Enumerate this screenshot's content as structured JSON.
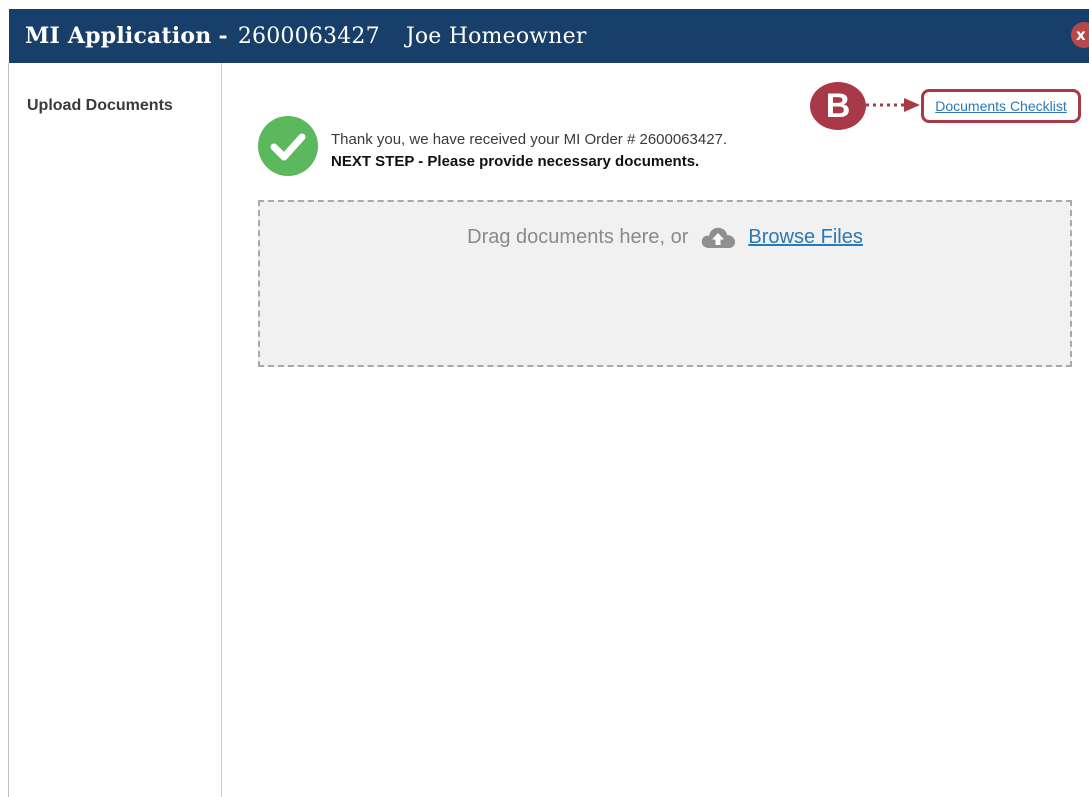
{
  "window": {
    "title_app": "MI Application",
    "title_separator": "-",
    "order_number": "2600063427",
    "applicant_name": "Joe Homeowner",
    "close_symbol": "x"
  },
  "sidebar": {
    "items": [
      {
        "label": "Upload Documents"
      }
    ]
  },
  "main": {
    "confirmation_line1": "Thank you, we have received your MI Order # 2600063427.",
    "confirmation_line2": "NEXT STEP - Please provide necessary documents.",
    "dropzone_text": "Drag documents here, or",
    "browse_label": "Browse Files",
    "checklist_label": "Documents Checklist"
  },
  "annotation": {
    "callout_letter": "B"
  },
  "icons": {
    "success": "check-circle-icon",
    "upload": "cloud-upload-icon",
    "close": "close-icon"
  },
  "colors": {
    "titlebar": "#173f6a",
    "success": "#5cb85c",
    "link": "#2a79b8",
    "callout": "#a83a48",
    "close": "#b8474a"
  }
}
